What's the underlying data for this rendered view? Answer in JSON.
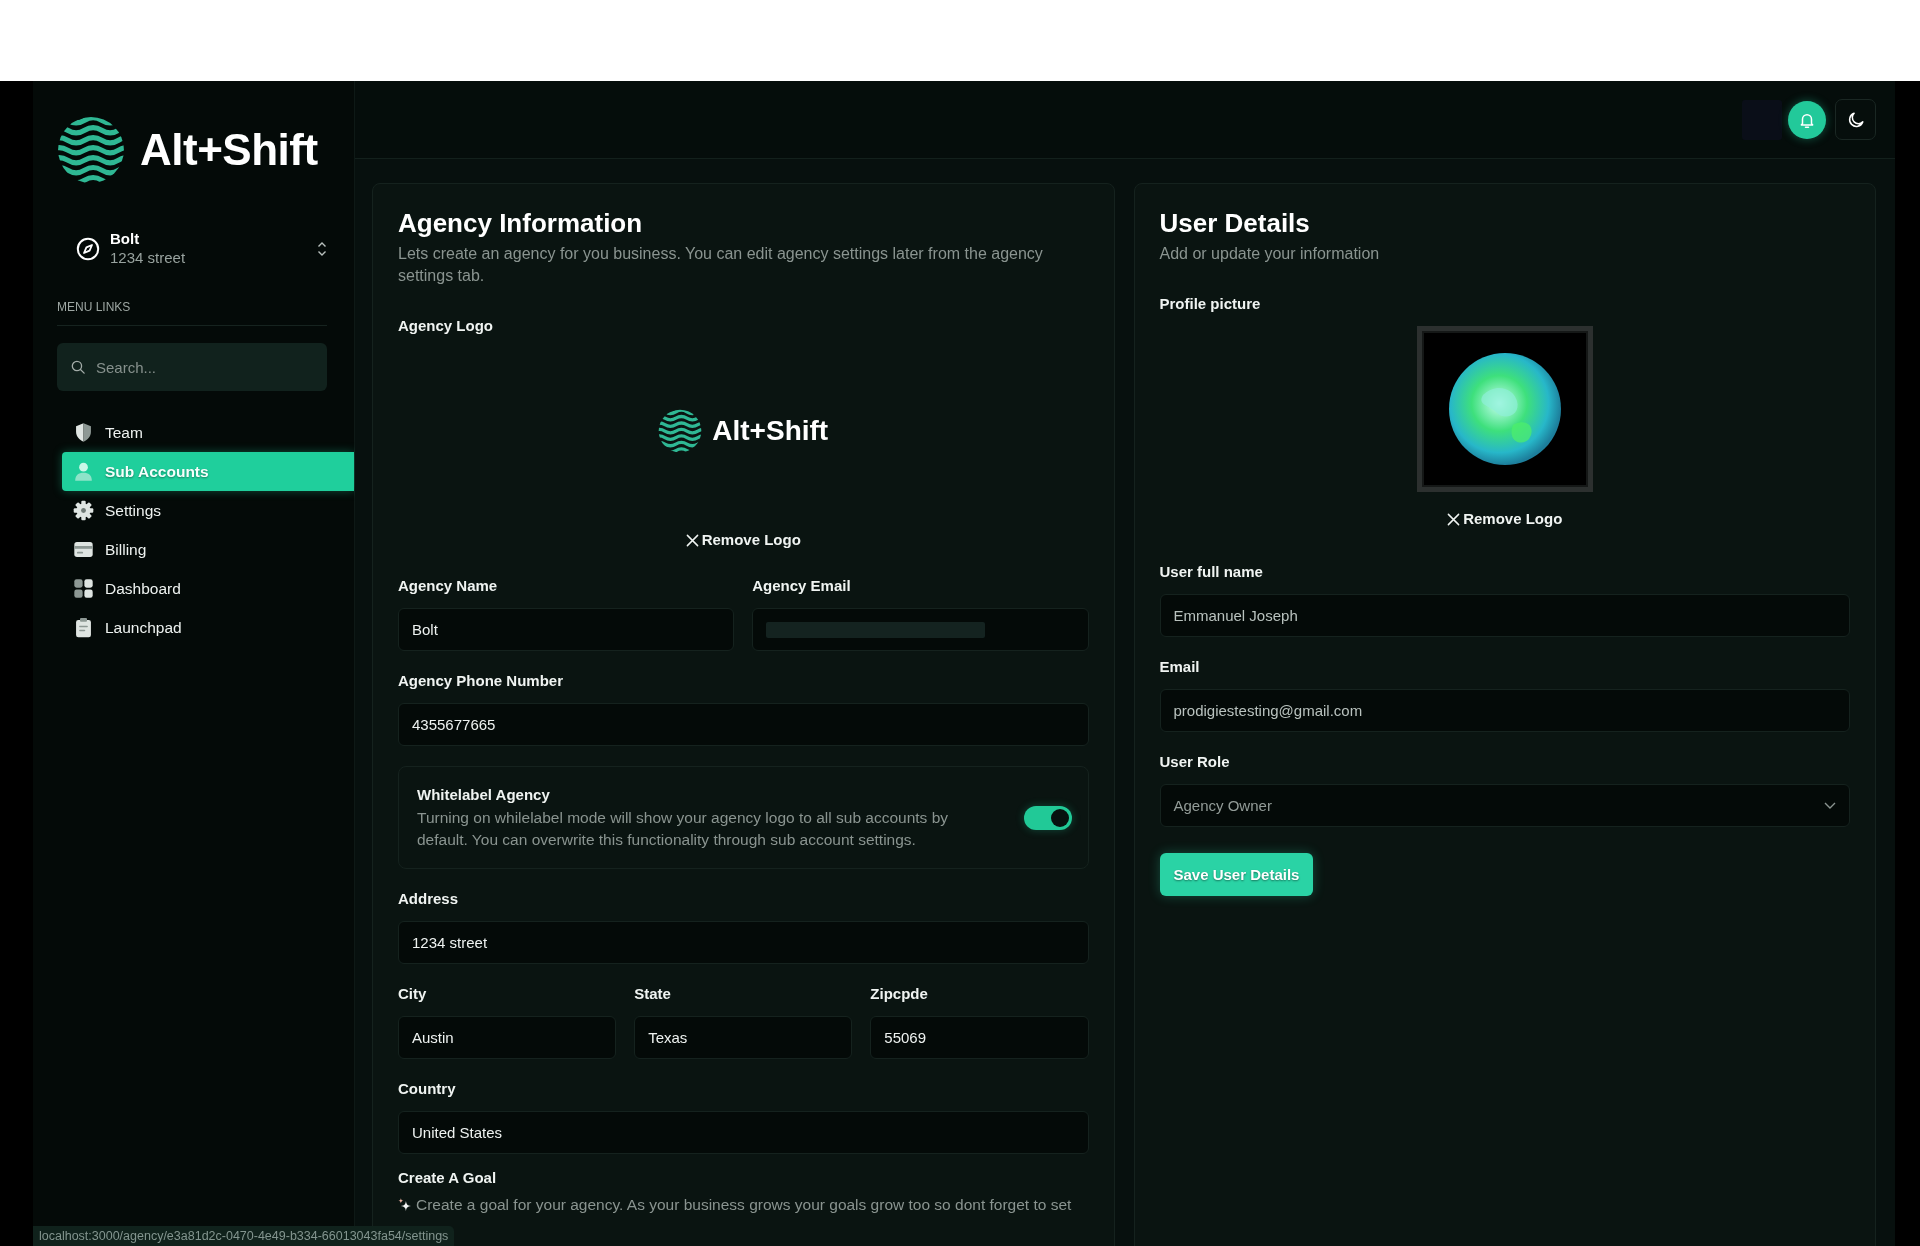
{
  "sidebar": {
    "logo_text": "Alt+Shift",
    "account": {
      "name": "Bolt",
      "address": "1234 street"
    },
    "section_label": "MENU LINKS",
    "search": {
      "placeholder": "Search..."
    },
    "items": [
      {
        "label": "Team",
        "selected": false
      },
      {
        "label": "Sub Accounts",
        "selected": true
      },
      {
        "label": "Settings",
        "selected": false
      },
      {
        "label": "Billing",
        "selected": false
      },
      {
        "label": "Dashboard",
        "selected": false
      },
      {
        "label": "Launchpad",
        "selected": false
      }
    ]
  },
  "agency": {
    "title": "Agency Information",
    "description": "Lets create an agency for you business. You can edit agency settings later from the agency settings tab.",
    "logo_label": "Agency Logo",
    "logo_text": "Alt+Shift",
    "remove_logo": "Remove Logo",
    "rows": [
      {
        "kind": "fields",
        "fields": [
          {
            "label": "Agency Name",
            "kind": "text",
            "value": "Bolt"
          },
          {
            "label": "Agency Email",
            "kind": "redacted"
          }
        ]
      },
      {
        "kind": "fields",
        "fields": [
          {
            "label": "Agency Phone Number",
            "kind": "text",
            "value": "4355677665"
          }
        ]
      },
      {
        "kind": "switch",
        "title": "Whitelabel Agency",
        "description": "Turning on whilelabel mode will show your agency logo to all sub accounts by default. You can overwrite this functionality through sub account settings.",
        "on": true
      },
      {
        "kind": "fields",
        "fields": [
          {
            "label": "Address",
            "kind": "text",
            "value": "1234 street"
          }
        ]
      },
      {
        "kind": "fields",
        "fields": [
          {
            "label": "City",
            "kind": "text",
            "value": "Austin"
          },
          {
            "label": "State",
            "kind": "text",
            "value": "Texas"
          },
          {
            "label": "Zipcpde",
            "kind": "text",
            "value": "55069"
          }
        ]
      },
      {
        "kind": "fields",
        "fields": [
          {
            "label": "Country",
            "kind": "text",
            "value": "United States"
          }
        ]
      },
      {
        "kind": "note",
        "title": "Create A Goal",
        "text": "Create a goal for your agency. As your business grows your goals grow too so dont forget to set"
      }
    ]
  },
  "user": {
    "title": "User Details",
    "description": "Add or update your information",
    "picture_label": "Profile picture",
    "remove_logo": "Remove Logo",
    "fields": [
      {
        "label": "User full name",
        "kind": "text",
        "value": "Emmanuel Joseph",
        "blurred": true
      },
      {
        "label": "Email",
        "kind": "text",
        "value": "prodigiestesting@gmail.com",
        "blurred": true
      },
      {
        "label": "User Role",
        "kind": "select",
        "value": "Agency Owner",
        "blurred": false
      }
    ],
    "save_button": "Save User Details"
  },
  "status_bar": {
    "url": "localhost:3000/agency/e3a81d2c-0470-4e49-b334-66013043fa54/settings"
  }
}
